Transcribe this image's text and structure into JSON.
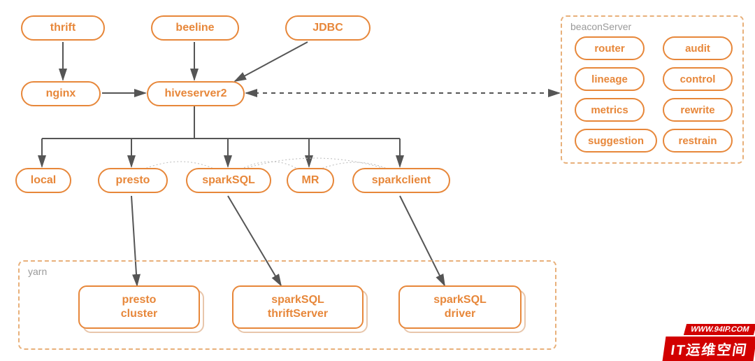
{
  "nodes": {
    "thrift": "thrift",
    "beeline": "beeline",
    "jdbc": "JDBC",
    "nginx": "nginx",
    "hiveserver2": "hiveserver2",
    "local": "local",
    "presto": "presto",
    "sparksql": "sparkSQL",
    "mr": "MR",
    "sparkclient": "sparkclient"
  },
  "yarn": {
    "label": "yarn",
    "prestoCluster": "presto\ncluster",
    "sparksqlThrift": "sparkSQL\nthriftServer",
    "sparksqlDriver": "sparkSQL\ndriver"
  },
  "beacon": {
    "label": "beaconServer",
    "router": "router",
    "audit": "audit",
    "lineage": "lineage",
    "control": "control",
    "metrics": "metrics",
    "rewrite": "rewrite",
    "suggestion": "suggestion",
    "restrain": "restrain"
  },
  "watermark": {
    "url": "WWW.94IP.COM",
    "text": "IT运维空间"
  },
  "diagram": {
    "edges_solid": [
      [
        "thrift",
        "nginx"
      ],
      [
        "beeline",
        "hiveserver2"
      ],
      [
        "jdbc",
        "hiveserver2"
      ],
      [
        "nginx",
        "hiveserver2"
      ],
      [
        "hiveserver2",
        "local"
      ],
      [
        "hiveserver2",
        "presto"
      ],
      [
        "hiveserver2",
        "sparkSQL"
      ],
      [
        "hiveserver2",
        "MR"
      ],
      [
        "hiveserver2",
        "sparkclient"
      ],
      [
        "presto",
        "presto cluster"
      ],
      [
        "sparkSQL",
        "sparkSQL thriftServer"
      ],
      [
        "sparkclient",
        "sparkSQL driver"
      ]
    ],
    "edges_dashed_bidirectional": [
      [
        "hiveserver2",
        "beaconServer"
      ]
    ],
    "edges_dotted": [
      [
        "presto",
        "sparkSQL"
      ],
      [
        "sparkSQL",
        "MR"
      ],
      [
        "sparkSQL",
        "sparkclient"
      ],
      [
        "MR",
        "sparkclient"
      ]
    ],
    "groups": {
      "yarn": [
        "presto cluster",
        "sparkSQL thriftServer",
        "sparkSQL driver"
      ],
      "beaconServer": [
        "router",
        "audit",
        "lineage",
        "control",
        "metrics",
        "rewrite",
        "suggestion",
        "restrain"
      ]
    }
  }
}
